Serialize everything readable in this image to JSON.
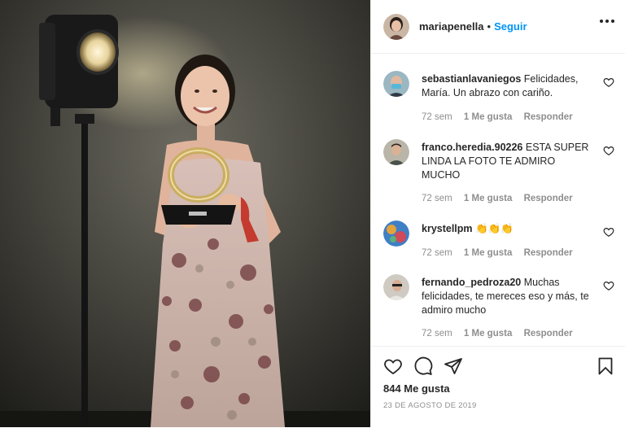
{
  "header": {
    "username": "mariapenella",
    "separator": "•",
    "follow_label": "Seguir"
  },
  "comments": [
    {
      "username": "sebastianlavaniegos",
      "text": "Felicidades, María. Un abrazo con cariño.",
      "time": "72 sem",
      "likes": "1 Me gusta",
      "reply": "Responder"
    },
    {
      "username": "franco.heredia.90226",
      "text": "ESTA SUPER LINDA LA FOTO TE ADMIRO MUCHO",
      "time": "72 sem",
      "likes": "1 Me gusta",
      "reply": "Responder"
    },
    {
      "username": "krystellpm",
      "text": "👏👏👏",
      "time": "72 sem",
      "likes": "1 Me gusta",
      "reply": "Responder"
    },
    {
      "username": "fernando_pedroza20",
      "text": "Muchas felicidades, te mereces eso y más, te admiro mucho",
      "time": "72 sem",
      "likes": "1 Me gusta",
      "reply": "Responder"
    }
  ],
  "footer": {
    "likes_count": "844 Me gusta",
    "date": "23 DE AGOSTO DE 2019"
  },
  "icons": {
    "like": "heart-icon",
    "comment": "comment-bubble-icon",
    "share": "paper-plane-icon",
    "save": "bookmark-icon",
    "more": "three-dots-icon"
  },
  "colors": {
    "follow_blue": "#0095f6",
    "muted_gray": "#8e8e8e",
    "divider": "#efefef"
  }
}
